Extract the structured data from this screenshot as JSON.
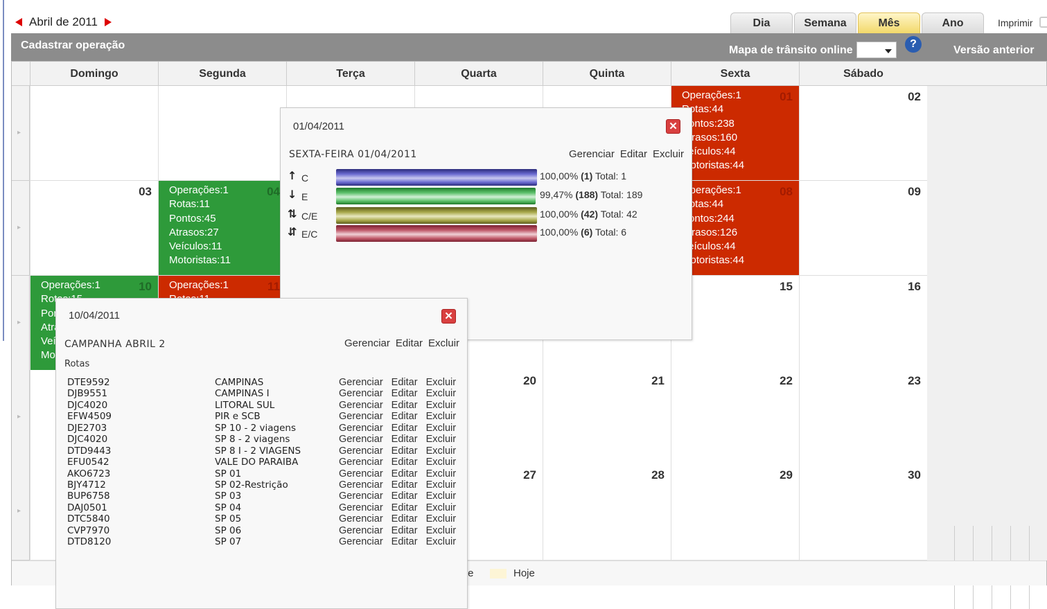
{
  "nav": {
    "month_label": "Abril de 2011"
  },
  "view_tabs": [
    {
      "label": "Dia",
      "active": false
    },
    {
      "label": "Semana",
      "active": false
    },
    {
      "label": "Mês",
      "active": true
    },
    {
      "label": "Ano",
      "active": false
    }
  ],
  "print_label": "Imprimir",
  "toolbar": {
    "cadastrar": "Cadastrar operação",
    "mapa": "Mapa de trânsito online",
    "help": "?",
    "versao": "Versão anterior"
  },
  "weekdays": [
    "Domingo",
    "Segunda",
    "Terça",
    "Quarta",
    "Quinta",
    "Sexta",
    "Sábado"
  ],
  "days": [
    {
      "row": 0,
      "col": 5,
      "num": "01",
      "status": "red",
      "lines": "Operações:1\nRotas:44\nPontos:238\nAtrasos:160\nVeículos:44\nMotoristas:44"
    },
    {
      "row": 0,
      "col": 6,
      "num": "02"
    },
    {
      "row": 1,
      "col": 0,
      "num": "03"
    },
    {
      "row": 1,
      "col": 1,
      "num": "04",
      "status": "green",
      "lines": "Operações:1\nRotas:11\nPontos:45\nAtrasos:27\nVeículos:11\nMotoristas:11"
    },
    {
      "row": 1,
      "col": 5,
      "num": "08",
      "status": "red",
      "lines": "Operações:1\nRotas:44\nPontos:244\nAtrasos:126\nVeículos:44\nMotoristas:44"
    },
    {
      "row": 1,
      "col": 6,
      "num": "09"
    },
    {
      "row": 2,
      "col": 0,
      "num": "10",
      "status": "green",
      "lines": "Operações:1\nRotas:15\nPontos\nAtrasos\nVeículos\nMotoristas"
    },
    {
      "row": 2,
      "col": 1,
      "num": "11",
      "status": "red",
      "lines": "Operações:1\nRotas:11"
    },
    {
      "row": 2,
      "col": 5,
      "num": "15"
    },
    {
      "row": 2,
      "col": 6,
      "num": "16"
    },
    {
      "row": 3,
      "col": 3,
      "num": "20"
    },
    {
      "row": 3,
      "col": 4,
      "num": "21"
    },
    {
      "row": 3,
      "col": 5,
      "num": "22"
    },
    {
      "row": 3,
      "col": 6,
      "num": "23"
    },
    {
      "row": 4,
      "col": 3,
      "num": "27"
    },
    {
      "row": 4,
      "col": 4,
      "num": "28"
    },
    {
      "row": 4,
      "col": 5,
      "num": "29"
    },
    {
      "row": 4,
      "col": 6,
      "num": "30"
    }
  ],
  "legend": {
    "partial": "te",
    "hoje": "Hoje"
  },
  "popup1": {
    "date": "01/04/2011",
    "title": "SEXTA-FEIRA 01/04/2011",
    "close": "✕",
    "actions": [
      "Gerenciar",
      "Editar",
      "Excluir"
    ],
    "bars": [
      {
        "arrow": "↑",
        "label": "C",
        "percent_text": "100,00%",
        "count": "(1)",
        "total": "Total: 1",
        "fill": 1.0,
        "colors": [
          "#2b2b7a",
          "#6a6ad0",
          "#c8c8f0"
        ]
      },
      {
        "arrow": "↓",
        "label": "E",
        "percent_text": "99,47%",
        "count": "(188)",
        "total": "Total: 189",
        "fill": 0.9947,
        "colors": [
          "#1f7a2a",
          "#5cc06a",
          "#d2f0d6"
        ]
      },
      {
        "arrow": "⇅",
        "label": "C/E",
        "percent_text": "100,00%",
        "count": "(42)",
        "total": "Total: 42",
        "fill": 1.0,
        "colors": [
          "#5b5b1c",
          "#a8a84a",
          "#e8e8c0"
        ]
      },
      {
        "arrow": "⇵",
        "label": "E/C",
        "percent_text": "100,00%",
        "count": "(6)",
        "total": "Total: 6",
        "fill": 1.0,
        "colors": [
          "#7a2030",
          "#c05a6a",
          "#f0d0d6"
        ]
      }
    ]
  },
  "popup2": {
    "date": "10/04/2011",
    "title": "CAMPANHA ABRIL 2",
    "close": "✕",
    "actions": [
      "Gerenciar",
      "Editar",
      "Excluir"
    ],
    "section_label": "Rotas",
    "routes": [
      {
        "plate": "DTE9592",
        "name": "CAMPINAS"
      },
      {
        "plate": "DJB9551",
        "name": "CAMPINAS I"
      },
      {
        "plate": "DJC4020",
        "name": "LITORAL SUL"
      },
      {
        "plate": "EFW4509",
        "name": "PIR e SCB"
      },
      {
        "plate": "DJE2703",
        "name": "SP 10 - 2 viagens"
      },
      {
        "plate": "DJC4020",
        "name": "SP 8 - 2 viagens"
      },
      {
        "plate": "DTD9443",
        "name": "SP 8 I - 2 VIAGENS"
      },
      {
        "plate": "EFU0542",
        "name": "VALE DO PARAIBA"
      },
      {
        "plate": "AKO6723",
        "name": "SP 01"
      },
      {
        "plate": "BJY4712",
        "name": "SP 02-Restrição"
      },
      {
        "plate": "BUP6758",
        "name": "SP 03"
      },
      {
        "plate": "DAJ0501",
        "name": "SP 04"
      },
      {
        "plate": "DTC5840",
        "name": "SP 05"
      },
      {
        "plate": "CVP7970",
        "name": "SP 06"
      },
      {
        "plate": "DTD8120",
        "name": "SP 07"
      }
    ],
    "route_actions": [
      "Gerenciar",
      "Editar",
      "Excluir"
    ]
  }
}
